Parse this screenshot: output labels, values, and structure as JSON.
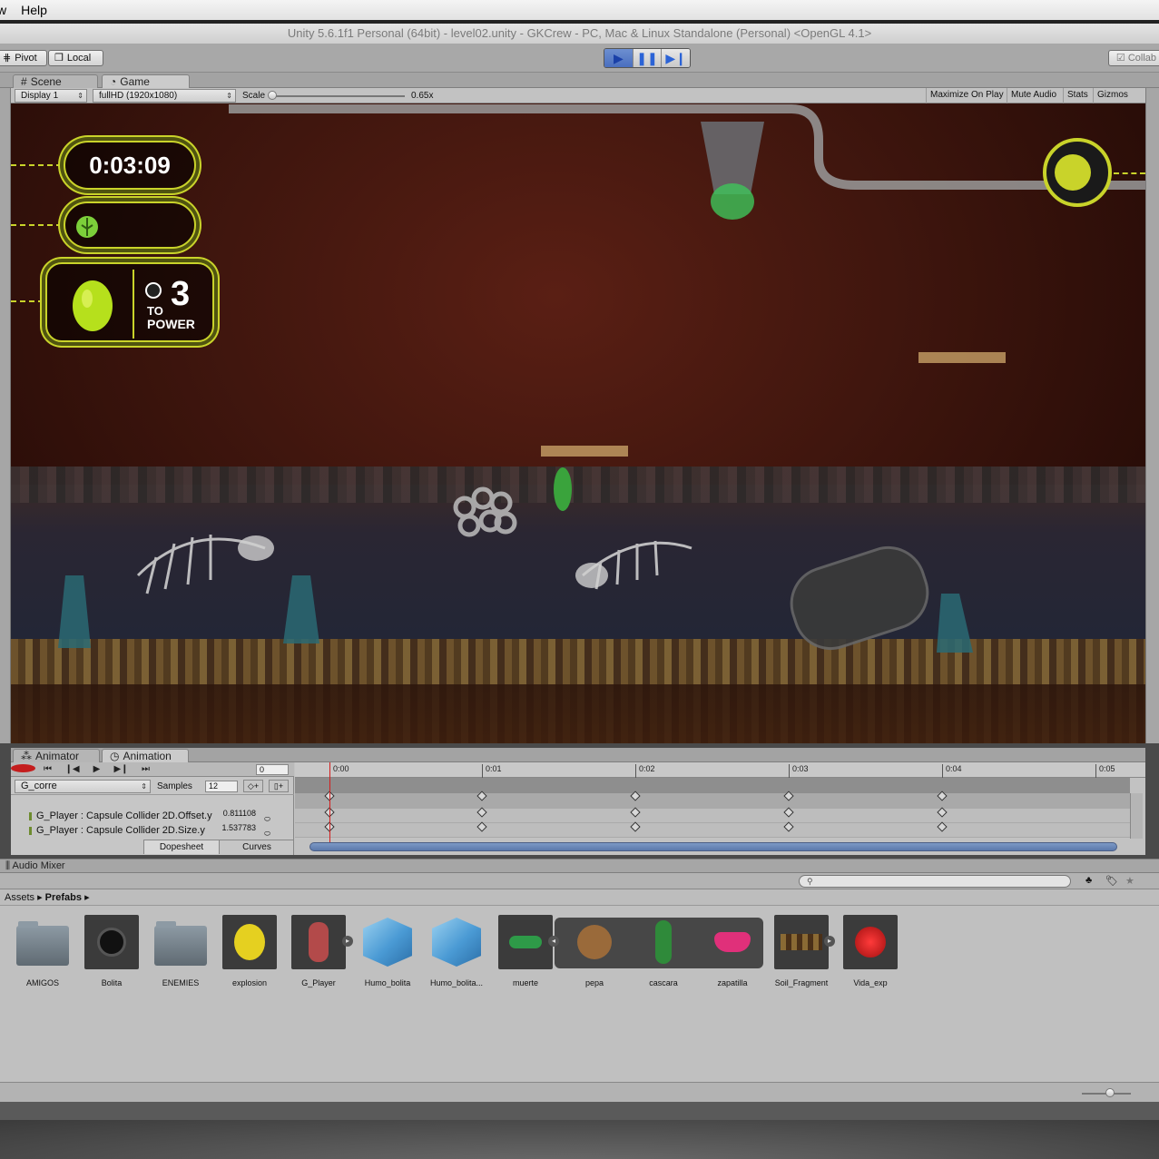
{
  "menubar": {
    "items": [
      "w",
      "Help"
    ]
  },
  "window": {
    "title": "Unity 5.6.1f1 Personal (64bit) - level02.unity - GKCrew - PC, Mac & Linux Standalone (Personal) <OpenGL 4.1>"
  },
  "toolbar": {
    "pivot": "Pivot",
    "local": "Local",
    "collab": "Collab"
  },
  "tabs": {
    "scene": "Scene",
    "game": "Game"
  },
  "game_view": {
    "display": "Display 1",
    "resolution": "fullHD (1920x1080)",
    "scale_label": "Scale",
    "scale_value": "0.65x",
    "maximize": "Maximize On Play",
    "mute": "Mute Audio",
    "stats": "Stats",
    "gizmos": "Gizmos"
  },
  "hud": {
    "timer": "0:03:09",
    "power_count": "3",
    "power_to": "TO",
    "power_label": "POWER"
  },
  "animation": {
    "tab_animator": "Animator",
    "tab_animation": "Animation",
    "frame": "0",
    "clip": "G_corre",
    "samples_label": "Samples",
    "samples_value": "12",
    "timeline_ticks": [
      "0:00",
      "0:01",
      "0:02",
      "0:03",
      "0:04",
      "0:05"
    ],
    "properties": [
      {
        "name": "G_Player : Capsule Collider 2D.Offset.y",
        "value": "0.811108"
      },
      {
        "name": "G_Player : Capsule Collider 2D.Size.y",
        "value": "1.537783"
      }
    ],
    "dopesheet": "Dopesheet",
    "curves": "Curves"
  },
  "audio_mixer": {
    "title": "Audio Mixer"
  },
  "project": {
    "breadcrumb": [
      "Assets",
      "Prefabs"
    ],
    "assets": [
      {
        "label": "AMIGOS",
        "kind": "folder"
      },
      {
        "label": "Bolita",
        "kind": "prefab"
      },
      {
        "label": "ENEMIES",
        "kind": "folder"
      },
      {
        "label": "explosion",
        "kind": "prefab"
      },
      {
        "label": "G_Player",
        "kind": "prefab"
      },
      {
        "label": "Humo_bolita",
        "kind": "cube"
      },
      {
        "label": "Humo_bolita...",
        "kind": "cube"
      },
      {
        "label": "muerte",
        "kind": "prefab"
      },
      {
        "label": "pepa",
        "kind": "sprite"
      },
      {
        "label": "cascara",
        "kind": "sprite"
      },
      {
        "label": "zapatilla",
        "kind": "sprite"
      },
      {
        "label": "Soil_Fragment",
        "kind": "prefab"
      },
      {
        "label": "Vida_exp",
        "kind": "prefab"
      }
    ]
  },
  "colors": {
    "hud_accent": "#c9d32a",
    "record": "#c41d1d",
    "play_active": "#4a6fbf"
  }
}
